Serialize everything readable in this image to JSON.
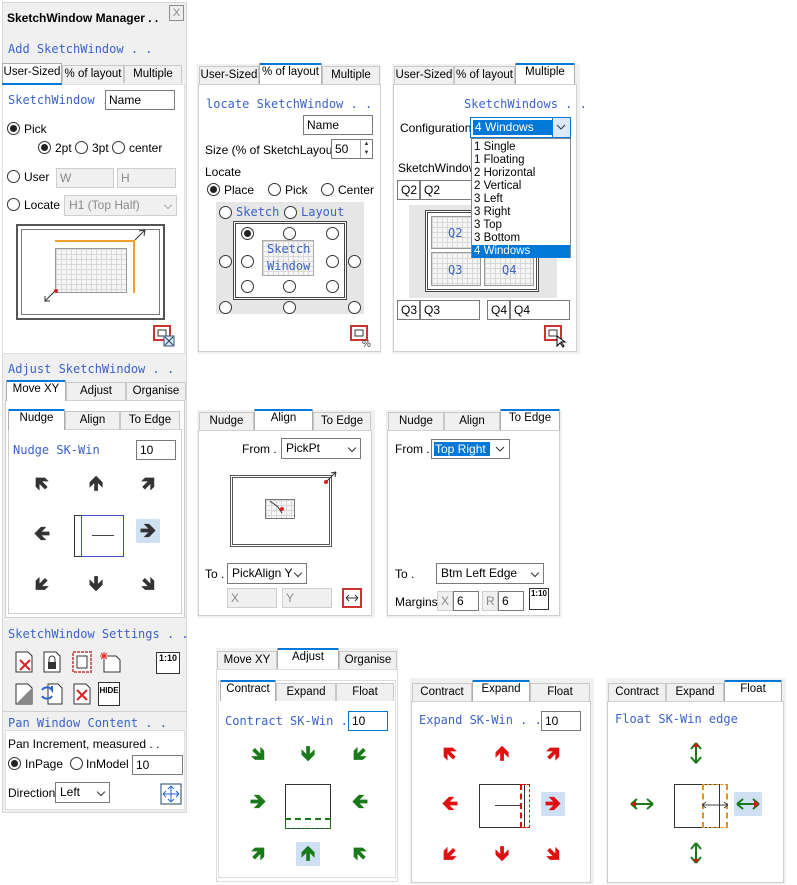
{
  "window": {
    "title": "SketchWindow Manager . .",
    "close_label": "X"
  },
  "add": {
    "heading": "Add SketchWindow . .",
    "tabs": [
      "User-Sized",
      "% of layout",
      "Multiple"
    ],
    "user": {
      "label": "SketchWindow .",
      "name_value": "Name",
      "pick_label": "Pick",
      "pt2": "2pt",
      "pt3": "3pt",
      "center": "center",
      "user_label": "User",
      "w": "W",
      "h": "H",
      "locate_label": "Locate",
      "locate_value": "H1  (Top Half)"
    },
    "percent": {
      "heading": "locate SketchWindow . .",
      "name_value": "Name",
      "size_label": "Size (% of SketchLayout)",
      "size_value": "50",
      "locate_label": "Locate",
      "place": "Place",
      "pick": "Pick",
      "center": "Center",
      "sketch": "Sketch",
      "layout": "Layout",
      "preview1": "Sketch",
      "preview2": "Window"
    },
    "multiple": {
      "heading": "SketchWindows . .",
      "config_label": "Configuration",
      "config_value": "4 Windows",
      "sw_label": "SketchWindow",
      "options": [
        "1 Single",
        "1 Floating",
        "2 Horizontal",
        "2 Vertical",
        "3 Left",
        "3 Right",
        "3 Top",
        "3 Bottom",
        "4 Windows"
      ],
      "q2": "Q2",
      "q2_value": "Q2",
      "q3": "Q3",
      "q3_value": "Q3",
      "q4": "Q4",
      "q4_value": "Q4"
    }
  },
  "adjust": {
    "heading": "Adjust SketchWindow . .",
    "tabs": [
      "Move XY",
      "Adjust",
      "Organise"
    ],
    "subtabs": [
      "Nudge",
      "Align",
      "To Edge"
    ],
    "nudge": {
      "label": "Nudge SK-Win",
      "value": "10"
    },
    "align": {
      "from_label": "From . .",
      "from_value": "PickPt",
      "to_label": "To .",
      "to_value": "PickAlign Y",
      "x": "X",
      "y": "Y"
    },
    "toedge": {
      "from_label": "From . .",
      "from_value": "Top Right",
      "to_label": "To .",
      "to_value": "Btm Left Edge",
      "margins": "Margins",
      "x": "X",
      "x_value": "6",
      "r": "R",
      "r_value": "6",
      "ratio_icon": "1:10"
    }
  },
  "settings": {
    "heading": "SketchWindow Settings . .",
    "ratio_icon": "1:10",
    "hide_icon": "HIDE"
  },
  "pan": {
    "heading": "Pan Window Content . .",
    "inc_label": "Pan Increment, measured . .",
    "inpage": "InPage",
    "inmodel": "InModel",
    "value": "10",
    "dir_label": "Direction",
    "dir_value": "Left"
  },
  "adjust2": {
    "tabs": [
      "Move XY",
      "Adjust",
      "Organise"
    ],
    "subtabs": [
      "Contract",
      "Expand",
      "Float"
    ],
    "contract": {
      "label": "Contract SK-Win . .",
      "value": "10"
    },
    "expand": {
      "label": "Expand SK-Win . .",
      "value": "10"
    },
    "float": {
      "label": "Float  SK-Win edge"
    }
  },
  "colors": {
    "accent": "#0078d7",
    "link": "#3b63c9",
    "green": "#1a7a1a",
    "red": "#e01010"
  }
}
